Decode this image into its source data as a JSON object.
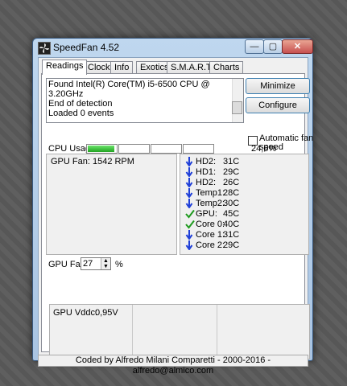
{
  "window": {
    "title": "SpeedFan 4.52"
  },
  "tabs": [
    {
      "label": "Readings",
      "active": true
    },
    {
      "label": "Clock"
    },
    {
      "label": "Info"
    },
    {
      "label": "Exotics"
    },
    {
      "label": "S.M.A.R.T."
    },
    {
      "label": "Charts"
    }
  ],
  "log": {
    "lines": [
      "Found Intel(R) Core(TM) i5-6500 CPU @ 3.20GHz",
      "End of detection",
      "Loaded 0 events"
    ]
  },
  "buttons": {
    "minimize": "Minimize",
    "configure": "Configure"
  },
  "auto_fan": {
    "label": "Automatic fan speed",
    "checked": false
  },
  "cpu_usage": {
    "label": "CPU Usage",
    "value_text": "24,6%",
    "cores": [
      0.95,
      0,
      0,
      0
    ]
  },
  "fans": {
    "gpu_fan": "GPU Fan: 1542 RPM"
  },
  "temps": [
    {
      "icon": "arrow-down-icon",
      "label": "HD2:",
      "value": "31C"
    },
    {
      "icon": "arrow-down-icon",
      "label": "HD1:",
      "value": "29C"
    },
    {
      "icon": "arrow-down-icon",
      "label": "HD2:",
      "value": "26C"
    },
    {
      "icon": "arrow-down-icon",
      "label": "Temp1:",
      "value": "28C"
    },
    {
      "icon": "arrow-down-icon",
      "label": "Temp2:",
      "value": "30C"
    },
    {
      "icon": "checkmark-icon",
      "label": "GPU:",
      "value": "45C"
    },
    {
      "icon": "checkmark-icon",
      "label": "Core 0:",
      "value": "40C"
    },
    {
      "icon": "arrow-down-icon",
      "label": "Core 1:",
      "value": "31C"
    },
    {
      "icon": "arrow-down-icon",
      "label": "Core 2:",
      "value": "29C"
    }
  ],
  "gpu_fan_control": {
    "label": "GPU Fan:",
    "value": "27",
    "unit": "%"
  },
  "voltages": {
    "label": "GPU Vddc:",
    "value": "0,95V"
  },
  "status_bar": "Coded by Alfredo Milani Comparetti - 2000-2016 - alfredo@almico.com",
  "colors": {
    "arrow_blue": "#1f3fd8",
    "check_green": "#1e9a1e",
    "cpu_green": "#2fbf2f"
  }
}
